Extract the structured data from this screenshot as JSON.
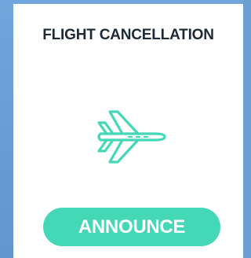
{
  "card": {
    "title": "FLIGHT CANCELLATION",
    "icon": "airplane-icon",
    "accent_color": "#44d8b6",
    "title_color": "#1f2a37"
  },
  "actions": {
    "announce_label": "ANNOUNCE"
  }
}
